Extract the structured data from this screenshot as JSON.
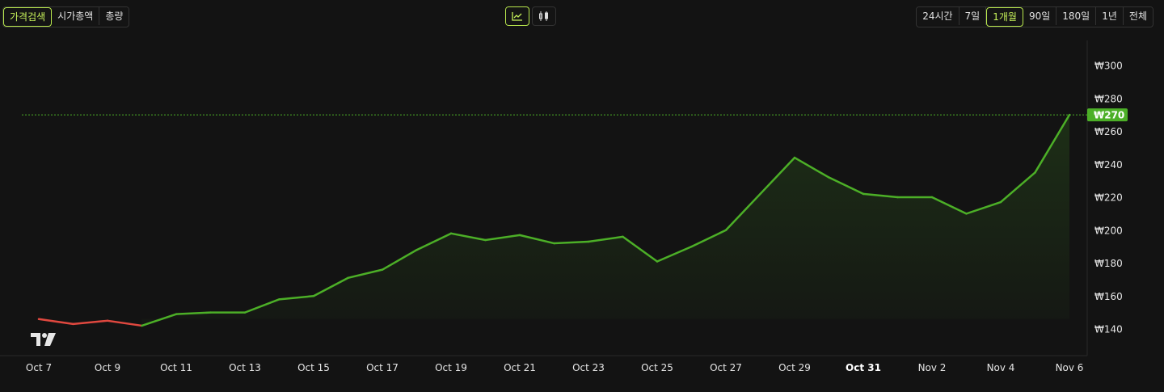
{
  "metric_tabs": [
    {
      "label": "가격검색",
      "active": true
    },
    {
      "label": "시가총액",
      "active": false
    },
    {
      "label": "총량",
      "active": false
    }
  ],
  "chart_type_buttons": [
    {
      "icon": "line-chart-icon",
      "active": true
    },
    {
      "icon": "candlestick-icon",
      "active": false
    }
  ],
  "range_tabs": [
    {
      "label": "24시간",
      "active": false
    },
    {
      "label": "7일",
      "active": false
    },
    {
      "label": "1개월",
      "active": true
    },
    {
      "label": "90일",
      "active": false
    },
    {
      "label": "180일",
      "active": false
    },
    {
      "label": "1년",
      "active": false
    },
    {
      "label": "전체",
      "active": false
    }
  ],
  "colors": {
    "up": "#4caf27",
    "down": "#e0483f",
    "label_bg": "#4caf27",
    "grid": "#2a2a2a"
  },
  "chart_data": {
    "type": "area",
    "x": [
      "Oct 7",
      "Oct 8",
      "Oct 9",
      "Oct 10",
      "Oct 11",
      "Oct 12",
      "Oct 13",
      "Oct 14",
      "Oct 15",
      "Oct 16",
      "Oct 17",
      "Oct 18",
      "Oct 19",
      "Oct 20",
      "Oct 21",
      "Oct 22",
      "Oct 23",
      "Oct 24",
      "Oct 25",
      "Oct 26",
      "Oct 27",
      "Oct 28",
      "Oct 29",
      "Oct 30",
      "Oct 31",
      "Nov 1",
      "Nov 2",
      "Nov 3",
      "Nov 4",
      "Nov 5",
      "Nov 6"
    ],
    "values": [
      146,
      143,
      145,
      142,
      149,
      150,
      150,
      158,
      160,
      171,
      176,
      188,
      198,
      194,
      197,
      192,
      193,
      196,
      181,
      190,
      200,
      222,
      244,
      232,
      222,
      220,
      220,
      210,
      217,
      235,
      270
    ],
    "x_tick_labels": [
      "Oct 7",
      "Oct 9",
      "Oct 11",
      "Oct 13",
      "Oct 15",
      "Oct 17",
      "Oct 19",
      "Oct 21",
      "Oct 23",
      "Oct 25",
      "Oct 27",
      "Oct 29",
      "Oct 31",
      "Nov 2",
      "Nov 4",
      "Nov 6"
    ],
    "bold_x_tick": "Oct 31",
    "y_ticks": [
      140,
      160,
      180,
      200,
      220,
      240,
      260,
      280,
      300
    ],
    "y_tick_labels": [
      "₩140",
      "₩160",
      "₩180",
      "₩200",
      "₩220",
      "₩240",
      "₩260",
      "₩280",
      "₩300"
    ],
    "ylim": [
      130,
      310
    ],
    "current_price": 270,
    "current_price_label": "₩270",
    "red_segment_end_index": 3,
    "grid": false,
    "logo": "TV"
  }
}
